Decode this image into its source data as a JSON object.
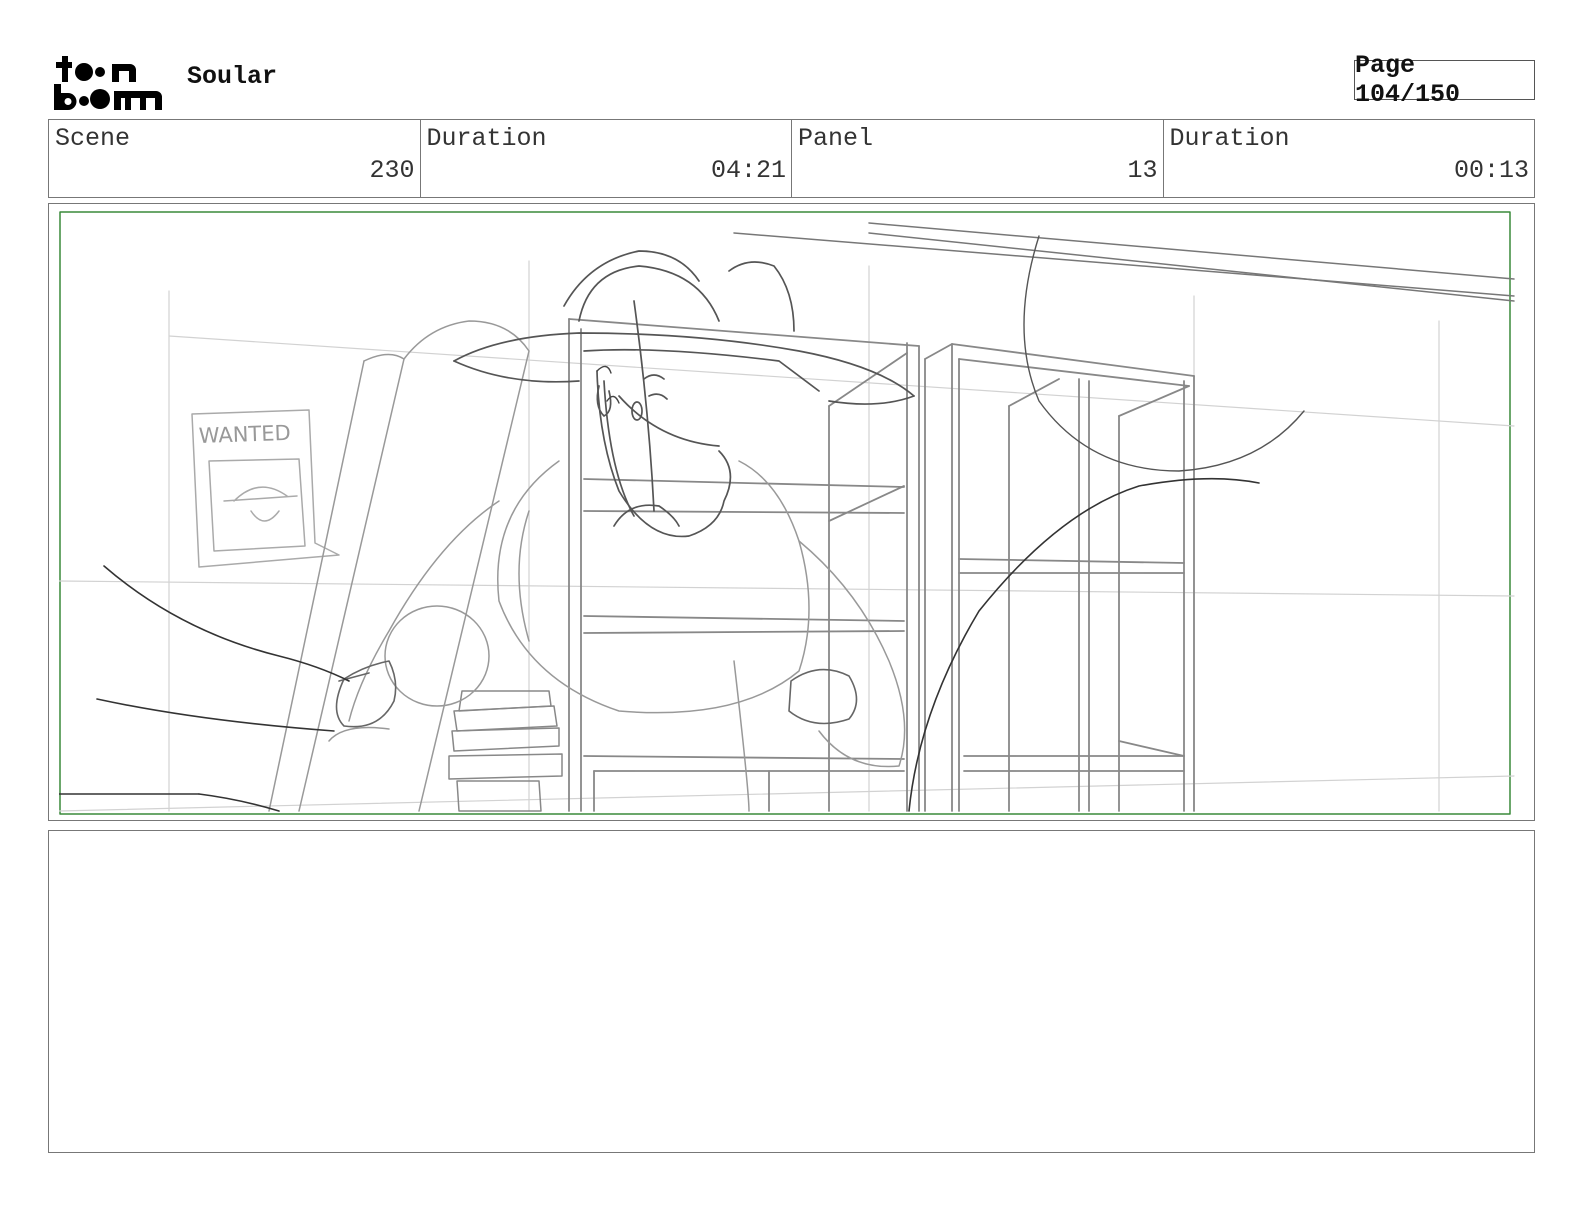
{
  "header": {
    "logo_text": "toon boom",
    "project_title": "Soular",
    "page_label": "Page 104/150"
  },
  "info": {
    "scene": {
      "label": "Scene",
      "value": "230"
    },
    "scene_duration": {
      "label": "Duration",
      "value": "04:21"
    },
    "panel": {
      "label": "Panel",
      "value": "13"
    },
    "panel_duration": {
      "label": "Duration",
      "value": "00:13"
    }
  },
  "sketch": {
    "poster_text": "WANTED"
  },
  "notes": {
    "text": ""
  },
  "colors": {
    "safe_frame": "#3a8a3a",
    "sketch_dark": "#333333",
    "sketch_light": "#b0b0b0"
  }
}
